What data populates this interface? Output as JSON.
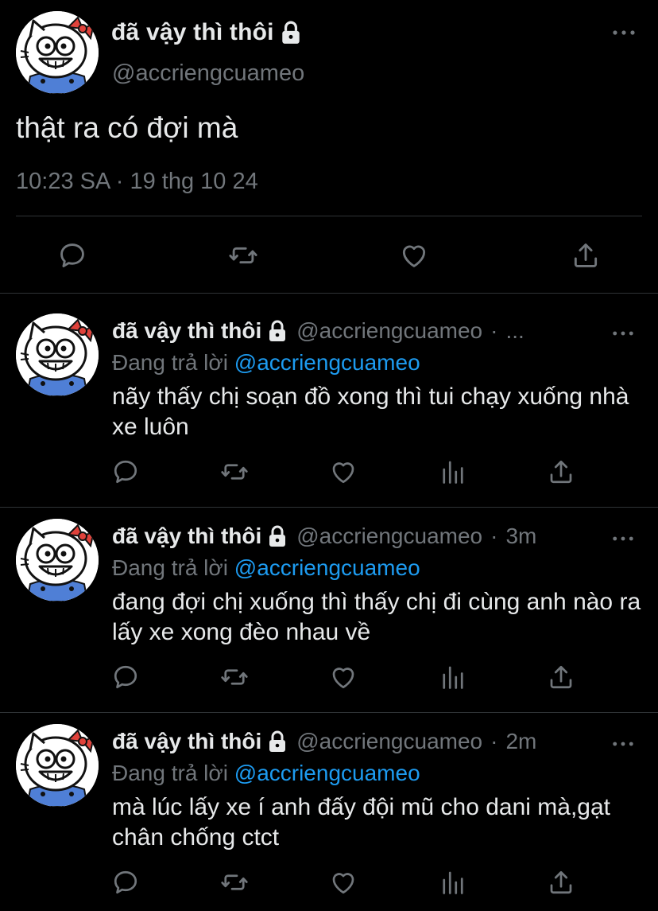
{
  "main_tweet": {
    "display_name": "đã vậy thì thôi",
    "handle": "@accriengcuameo",
    "text": "thật ra có đợi mà",
    "timestamp": "10:23 SA · 19 thg 10 24",
    "icons": [
      "reply-icon",
      "retweet-icon",
      "like-icon",
      "share-icon"
    ]
  },
  "replies": [
    {
      "display_name": "đã vậy thì thôi",
      "handle": "@accriengcuameo",
      "separator": "·",
      "time": "...",
      "replying_prefix": "Đang trả lời",
      "replying_to": "@accriengcuameo",
      "text": "nãy thấy chị soạn đồ xong thì tui chạy xuống nhà xe luôn"
    },
    {
      "display_name": "đã vậy thì thôi",
      "handle": "@accriengcuameo",
      "separator": "·",
      "time": "3m",
      "replying_prefix": "Đang trả lời",
      "replying_to": "@accriengcuameo",
      "text": "đang đợi chị xuống thì thấy chị đi cùng anh nào ra lấy xe xong đèo nhau về"
    },
    {
      "display_name": "đã vậy thì thôi",
      "handle": "@accriengcuameo",
      "separator": "·",
      "time": "2m",
      "replying_prefix": "Đang trả lời",
      "replying_to": "@accriengcuameo",
      "text": "mà lúc lấy xe í anh đấy đội mũ cho dani mà,gạt chân chống ctct"
    }
  ],
  "colors": {
    "background": "#000000",
    "text": "#e7e9ea",
    "secondary": "#71767b",
    "link": "#1d9bf0",
    "divider": "#2f3336"
  }
}
